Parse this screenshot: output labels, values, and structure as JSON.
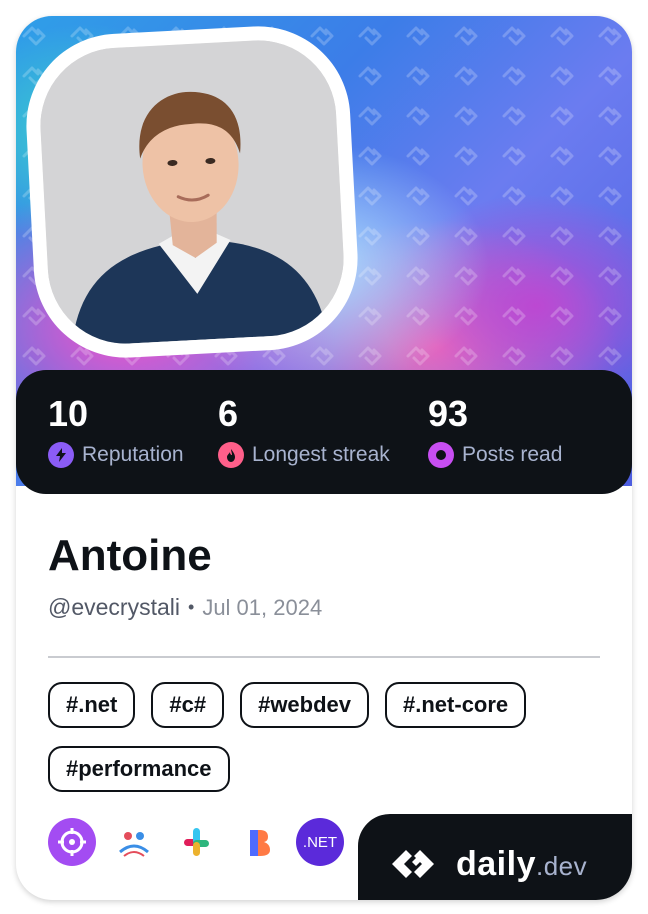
{
  "profile": {
    "name": "Antoine",
    "handle": "@evecrystali",
    "separator": "•",
    "joined_date": "Jul 01, 2024"
  },
  "stats": [
    {
      "value": "10",
      "label": "Reputation",
      "icon": "bolt-icon",
      "color": "#8b5cf6"
    },
    {
      "value": "6",
      "label": "Longest streak",
      "icon": "flame-icon",
      "color": "#ff5f8a"
    },
    {
      "value": "93",
      "label": "Posts read",
      "icon": "eye-ring-icon",
      "color": "#c84ef2"
    }
  ],
  "tags": [
    "#.net",
    "#c#",
    "#webdev",
    "#.net-core",
    "#performance"
  ],
  "sources": [
    {
      "icon": "crosshair-icon",
      "color": "#a34cf2"
    },
    {
      "icon": "community-logo-icon",
      "color": "#ffffff"
    },
    {
      "icon": "slack-logo-icon",
      "color": "#ffffff"
    },
    {
      "icon": "b-logo-icon",
      "color": "#ffffff"
    },
    {
      "icon": "dotnet-logo-icon",
      "color": "#5b2ada",
      "text": ".NET"
    }
  ],
  "brand": {
    "name": "daily",
    "tld": ".dev"
  },
  "colors": {
    "dark": "#0e1217",
    "muted": "#a8b3cf"
  }
}
